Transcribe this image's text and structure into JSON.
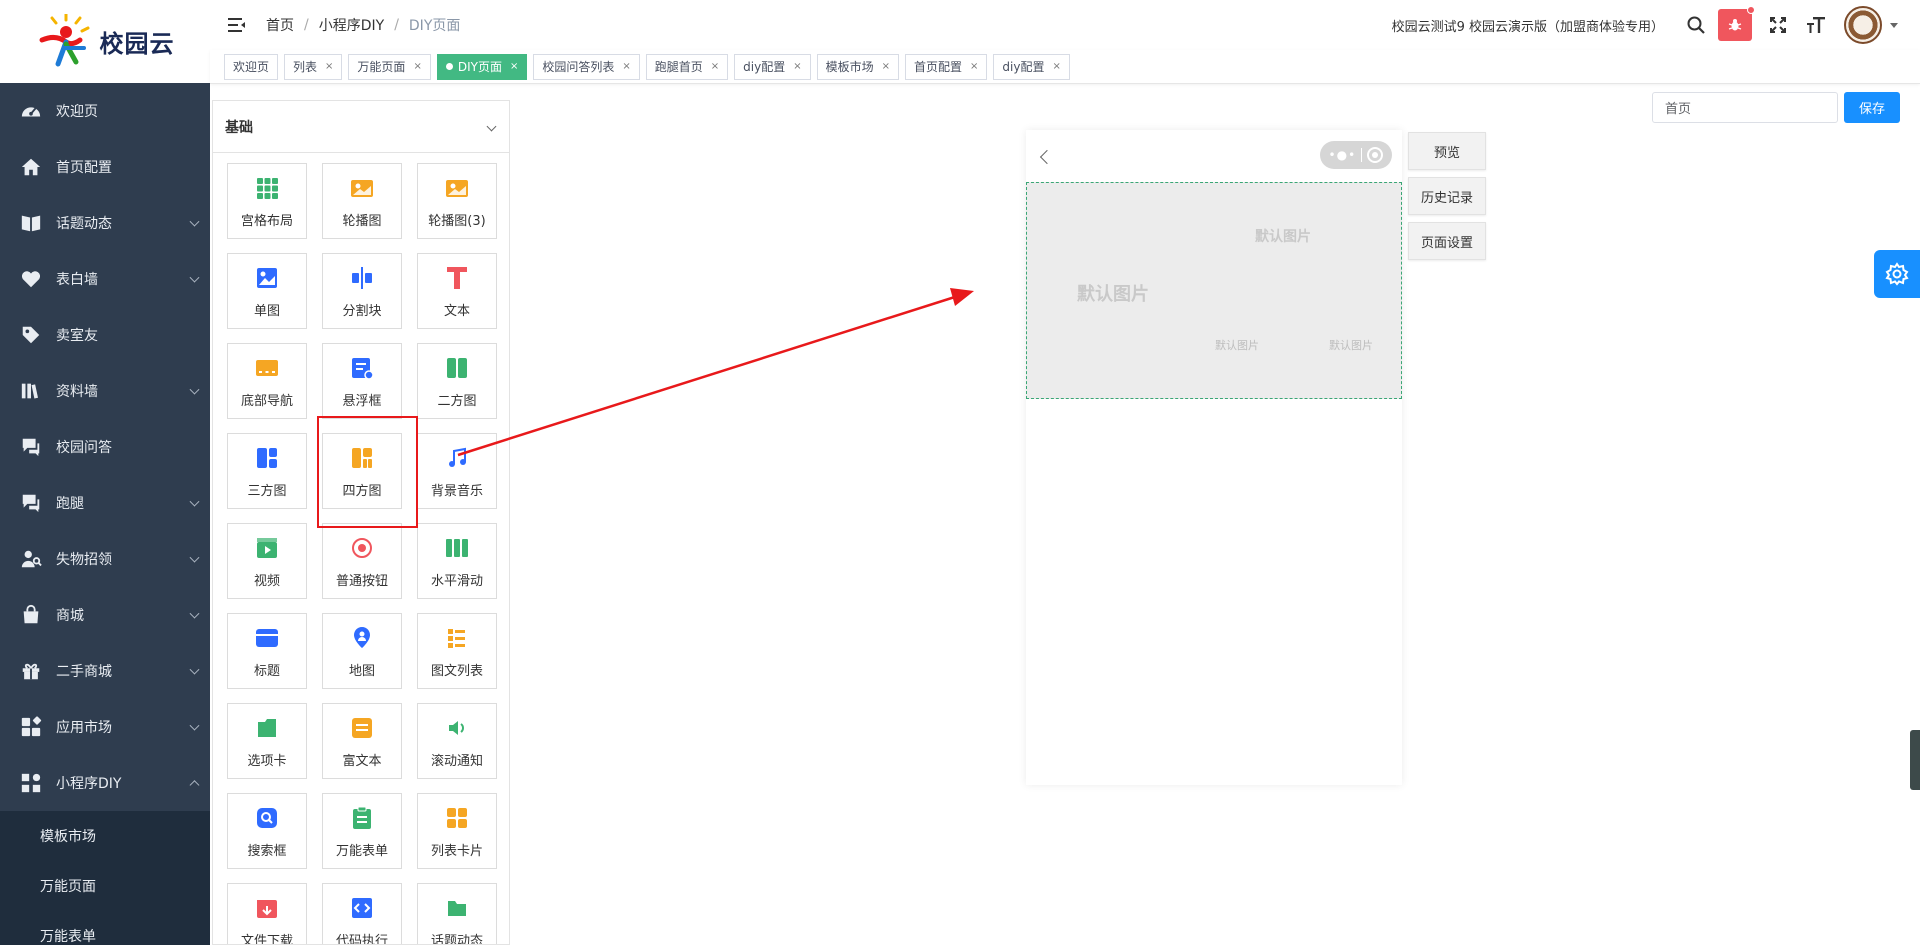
{
  "logo": {
    "text": "校园云"
  },
  "sidebar": {
    "items": [
      {
        "label": "欢迎页",
        "icon": "dashboard-icon",
        "expandable": false
      },
      {
        "label": "首页配置",
        "icon": "home-icon",
        "expandable": false
      },
      {
        "label": "话题动态",
        "icon": "book-icon",
        "expandable": true
      },
      {
        "label": "表白墙",
        "icon": "heart-icon",
        "expandable": true
      },
      {
        "label": "卖室友",
        "icon": "tag-icon",
        "expandable": false
      },
      {
        "label": "资料墙",
        "icon": "library-icon",
        "expandable": true
      },
      {
        "label": "校园问答",
        "icon": "qa-icon",
        "expandable": false
      },
      {
        "label": "跑腿",
        "icon": "qa-icon",
        "expandable": true
      },
      {
        "label": "失物招领",
        "icon": "search-person-icon",
        "expandable": true
      },
      {
        "label": "商城",
        "icon": "shop-icon",
        "expandable": true
      },
      {
        "label": "二手商城",
        "icon": "gift-icon",
        "expandable": true
      },
      {
        "label": "应用市场",
        "icon": "apps-icon",
        "expandable": true
      },
      {
        "label": "小程序DIY",
        "icon": "diy-icon",
        "expandable": true,
        "expanded": true
      }
    ],
    "submenu": [
      "模板市场",
      "万能页面",
      "万能表单"
    ]
  },
  "header": {
    "breadcrumb": [
      "首页",
      "小程序DIY",
      "DIY页面"
    ],
    "account": "校园云测试9 校园云演示版（加盟商体验专用）"
  },
  "tags": [
    {
      "label": "欢迎页",
      "closable": false,
      "active": false
    },
    {
      "label": "列表",
      "closable": true,
      "active": false
    },
    {
      "label": "万能页面",
      "closable": true,
      "active": false
    },
    {
      "label": "DIY页面",
      "closable": true,
      "active": true
    },
    {
      "label": "校园问答列表",
      "closable": true,
      "active": false
    },
    {
      "label": "跑腿首页",
      "closable": true,
      "active": false
    },
    {
      "label": "diy配置",
      "closable": true,
      "active": false
    },
    {
      "label": "模板市场",
      "closable": true,
      "active": false
    },
    {
      "label": "首页配置",
      "closable": true,
      "active": false
    },
    {
      "label": "diy配置",
      "closable": true,
      "active": false
    }
  ],
  "panel": {
    "title": "基础",
    "components": [
      {
        "label": "宫格布局",
        "icon": "grid-layout-icon",
        "color": "#3cb371"
      },
      {
        "label": "轮播图",
        "icon": "carousel-icon",
        "color": "#f5a623"
      },
      {
        "label": "轮播图(3)",
        "icon": "carousel-icon",
        "color": "#f5a623"
      },
      {
        "label": "单图",
        "icon": "image-icon",
        "color": "#2f6bff"
      },
      {
        "label": "分割块",
        "icon": "divider-icon",
        "color": "#2f6bff"
      },
      {
        "label": "文本",
        "icon": "text-icon",
        "color": "#f0565d"
      },
      {
        "label": "底部导航",
        "icon": "bottom-nav-icon",
        "color": "#f5a623"
      },
      {
        "label": "悬浮框",
        "icon": "float-box-icon",
        "color": "#2f6bff"
      },
      {
        "label": "二方图",
        "icon": "two-grid-icon",
        "color": "#3cb371"
      },
      {
        "label": "三方图",
        "icon": "three-grid-icon",
        "color": "#2f6bff"
      },
      {
        "label": "四方图",
        "icon": "four-grid-icon",
        "color": "#f5a623"
      },
      {
        "label": "背景音乐",
        "icon": "music-icon",
        "color": "#2f6bff"
      },
      {
        "label": "视频",
        "icon": "video-icon",
        "color": "#3cb371"
      },
      {
        "label": "普通按钮",
        "icon": "button-icon",
        "color": "#f0565d"
      },
      {
        "label": "水平滑动",
        "icon": "slider-icon",
        "color": "#3cb371"
      },
      {
        "label": "标题",
        "icon": "title-icon",
        "color": "#2f6bff"
      },
      {
        "label": "地图",
        "icon": "map-pin-icon",
        "color": "#2f6bff"
      },
      {
        "label": "图文列表",
        "icon": "list-icon",
        "color": "#f5a623"
      },
      {
        "label": "选项卡",
        "icon": "tabs-icon",
        "color": "#3cb371"
      },
      {
        "label": "富文本",
        "icon": "rich-text-icon",
        "color": "#f5a623"
      },
      {
        "label": "滚动通知",
        "icon": "speaker-icon",
        "color": "#3cb371"
      },
      {
        "label": "搜索框",
        "icon": "search-box-icon",
        "color": "#2f6bff"
      },
      {
        "label": "万能表单",
        "icon": "form-icon",
        "color": "#3cb371"
      },
      {
        "label": "列表卡片",
        "icon": "card-list-icon",
        "color": "#f5a623"
      },
      {
        "label": "文件下载",
        "icon": "download-icon",
        "color": "#f0565d"
      },
      {
        "label": "代码执行",
        "icon": "code-icon",
        "color": "#2f6bff"
      },
      {
        "label": "话题动态",
        "icon": "folder-icon",
        "color": "#3cb371"
      }
    ]
  },
  "preview": {
    "placeholders": [
      "默认图片",
      "默认图片",
      "默认图片",
      "默认图片"
    ]
  },
  "side_buttons": [
    "预览",
    "历史记录",
    "页面设置"
  ],
  "toolbar": {
    "page_value": "首页",
    "save_label": "保存"
  },
  "colors": {
    "sidebar_bg": "#2f3d4f",
    "active_tag": "#42b983",
    "primary": "#1890ff",
    "highlight": "#e8191b"
  }
}
